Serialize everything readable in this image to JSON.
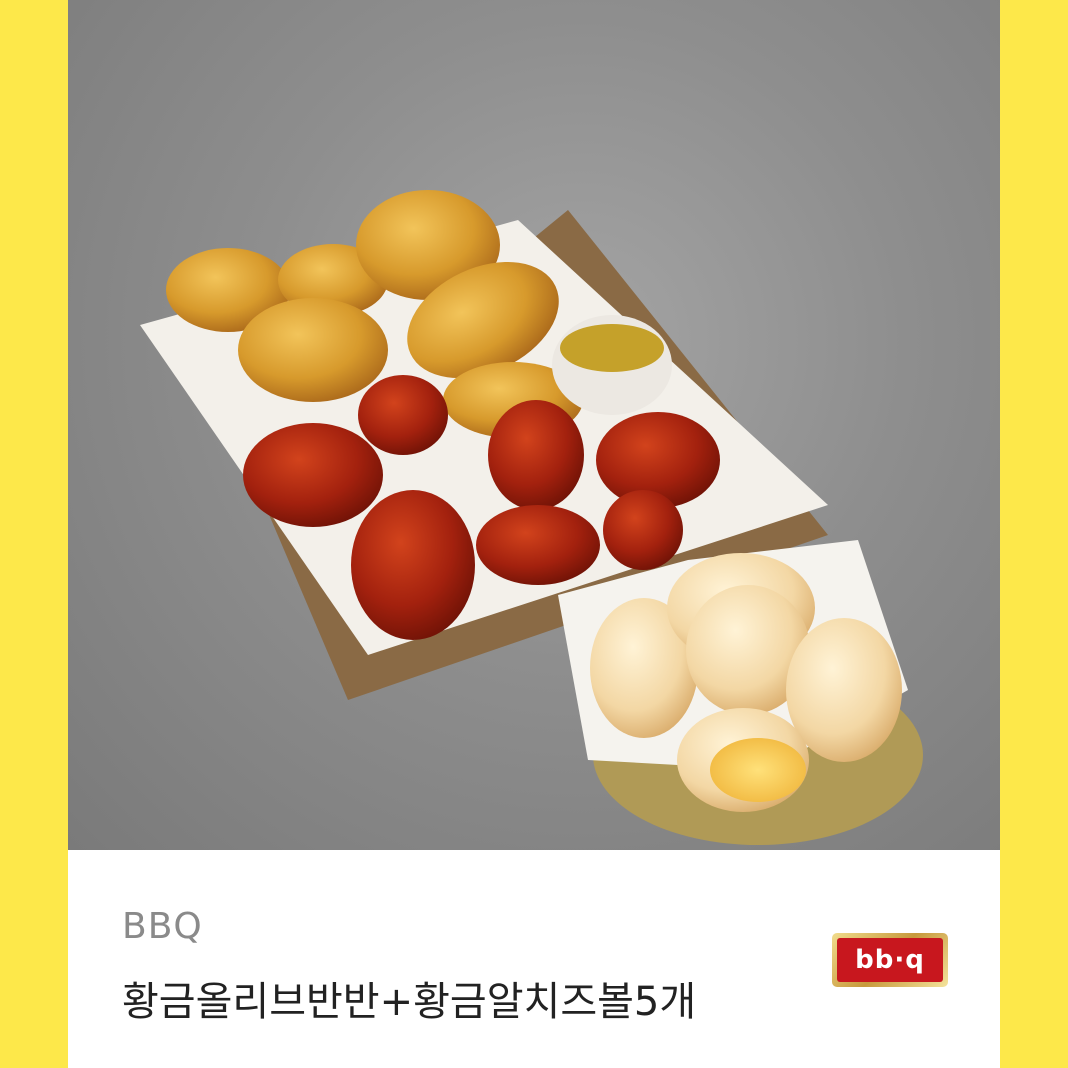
{
  "product": {
    "brand": "BBQ",
    "title": "황금올리브반반+황금알치즈볼5개",
    "logo_text": "bb·q",
    "image_icon": "fried-chicken-and-cheese-balls-photo"
  },
  "colors": {
    "frame_background": "#fde84a",
    "card_background": "#ffffff",
    "logo_red": "#c8171e",
    "logo_gold": "#d8b25a",
    "brand_text": "#8a8a8a",
    "title_text": "#222222"
  }
}
